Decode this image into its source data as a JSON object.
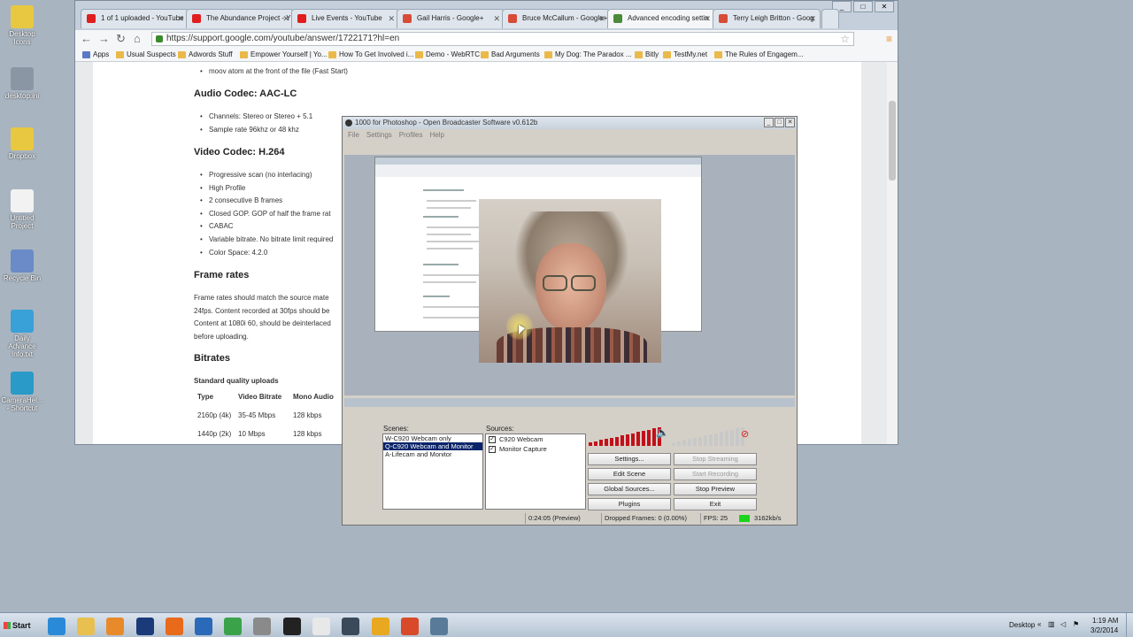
{
  "desktop": {
    "icons": [
      {
        "label": "Desktop Icons",
        "color": "#e8c840"
      },
      {
        "label": "desktop.ini",
        "color": "#8a96a4"
      },
      {
        "label": "Dropbox",
        "color": "#e8c840"
      },
      {
        "label": "Untitled Project",
        "color": "#f2f2f2"
      },
      {
        "label": "Recycle Bin",
        "color": "#6a8ac8"
      },
      {
        "label": "Daily Advance Info.txt",
        "color": "#3aa0d8"
      },
      {
        "label": "CameraHel... - Shortcut",
        "color": "#2a9ac8"
      }
    ]
  },
  "browser": {
    "tabs": [
      {
        "title": "1 of 1 uploaded - YouTube",
        "icon": "youtube-icon",
        "color": "#e01e1e"
      },
      {
        "title": "The Abundance Project - Y",
        "icon": "youtube-icon",
        "color": "#e01e1e"
      },
      {
        "title": "Live Events - YouTube",
        "icon": "youtube-icon",
        "color": "#e01e1e"
      },
      {
        "title": "Gail Harris - Google+",
        "icon": "google-plus-icon",
        "color": "#d84b36"
      },
      {
        "title": "Bruce McCallum - Google+",
        "icon": "google-plus-icon",
        "color": "#d84b36"
      },
      {
        "title": "Advanced encoding settin",
        "icon": "google-help-icon",
        "color": "#4a8a3a"
      },
      {
        "title": "Terry Leigh Britton - Goog",
        "icon": "google-plus-icon",
        "color": "#d84b36"
      }
    ],
    "url": "https://support.google.com/youtube/answer/1722171?hl=en",
    "bookmarks": [
      "Apps",
      "Usual Suspects",
      "Adwords Stuff",
      "Empower Yourself | Yo...",
      "How To Get Involved i...",
      "Demo - WebRTC",
      "Bad Arguments",
      "My Dog: The Paradox ...",
      "Bitly",
      "TestMy.net",
      "The Rules of Engagem..."
    ],
    "page": {
      "audio_header": "Audio Codec: AAC-LC",
      "moov_item": "moov atom at the front of the file (Fast Start)",
      "audio_items": [
        "Channels: Stereo or Stereo + 5.1",
        "Sample rate 96khz or 48 khz"
      ],
      "video_header": "Video Codec: H.264",
      "video_items": [
        "Progressive scan (no interlacing)",
        "High Profile",
        "2 consecutive B frames",
        "Closed GOP. GOP of half the frame rat",
        "CABAC",
        "Variable bitrate. No bitrate limit required",
        "Color Space: 4.2.0"
      ],
      "frame_header": "Frame rates",
      "frame_lines": [
        "Frame rates should match the source mate",
        "24fps. Content recorded at 30fps should be",
        "Content at 1080i 60, should be deinterlaced",
        "before uploading."
      ],
      "bitrates_header": "Bitrates",
      "standard_label": "Standard quality uploads",
      "table_headers": [
        "Type",
        "Video Bitrate",
        "Mono Audio"
      ],
      "table_rows": [
        [
          "2160p (4k)",
          "35-45 Mbps",
          "128 kbps"
        ],
        [
          "1440p (2k)",
          "10 Mbps",
          "128 kbps"
        ]
      ]
    }
  },
  "obs": {
    "title": "1000 for Photoshop - Open Broadcaster Software v0.612b",
    "menu": [
      "File",
      "Settings",
      "Profiles",
      "Help"
    ],
    "scenes_label": "Scenes:",
    "scenes": [
      "W-C920 Webcam only",
      "Q-C920 Webcam and Monitor",
      "A-Lifecam and Monitor"
    ],
    "selected_scene": 1,
    "sources_label": "Sources:",
    "sources": [
      {
        "name": "C920 Webcam",
        "checked": "✓"
      },
      {
        "name": "Monitor Capture",
        "checked": "✓"
      }
    ],
    "buttons": {
      "settings": "Settings...",
      "stop_streaming": "Stop Streaming",
      "edit_scene": "Edit Scene",
      "start_recording": "Start Recording",
      "global_sources": "Global Sources...",
      "stop_preview": "Stop Preview",
      "plugins": "Plugins",
      "exit": "Exit"
    },
    "status": {
      "time": "0:24:05 (Preview)",
      "dropped": "Dropped Frames: 0 (0.00%)",
      "fps": "FPS: 25",
      "bitrate": "3162kb/s"
    }
  },
  "taskbar": {
    "start": "Start",
    "desktop_label": "Desktop",
    "time": "1:19 AM",
    "date": "3/2/2014",
    "icons": [
      {
        "name": "ie-icon",
        "color": "#2a8ad8"
      },
      {
        "name": "folder-icon",
        "color": "#e8c050"
      },
      {
        "name": "media-player-icon",
        "color": "#e88a2a"
      },
      {
        "name": "check-icon",
        "color": "#1a3a7a"
      },
      {
        "name": "firefox-icon",
        "color": "#e86a1a"
      },
      {
        "name": "star-app-icon",
        "color": "#2a6ab8"
      },
      {
        "name": "chrome-icon",
        "color": "#3aa34a"
      },
      {
        "name": "camera-icon",
        "color": "#8a8a8a"
      },
      {
        "name": "obs-icon",
        "color": "#222222"
      },
      {
        "name": "alien-icon",
        "color": "#e8e8e8"
      },
      {
        "name": "window-icon",
        "color": "#3a4a5a"
      },
      {
        "name": "headphones-icon",
        "color": "#e8a820"
      },
      {
        "name": "grid-icon",
        "color": "#d84a2a"
      },
      {
        "name": "screen-capture-icon",
        "color": "#5a7a9a"
      }
    ]
  }
}
